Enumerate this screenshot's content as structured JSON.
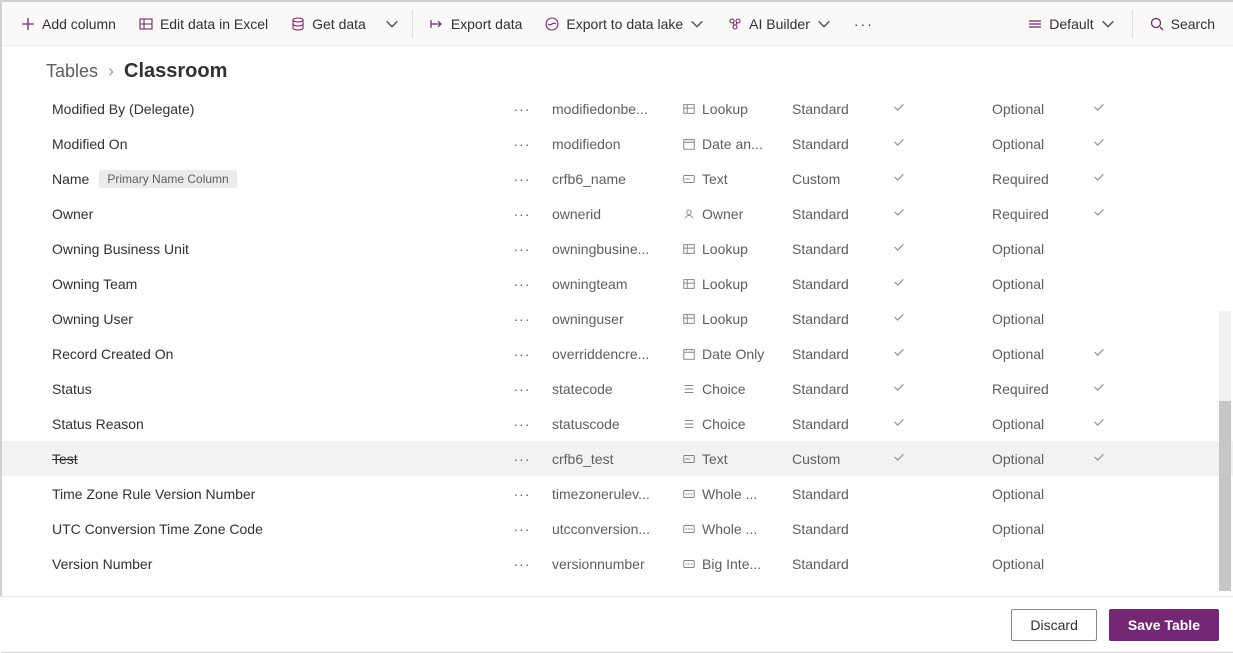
{
  "toolbar": {
    "add_column": "Add column",
    "edit_excel": "Edit data in Excel",
    "get_data": "Get data",
    "export_data": "Export data",
    "export_lake": "Export to data lake",
    "ai_builder": "AI Builder",
    "view_default": "Default",
    "search_placeholder": "Search"
  },
  "breadcrumb": {
    "parent": "Tables",
    "current": "Classroom"
  },
  "badges": {
    "primary_name": "Primary Name Column"
  },
  "rows": [
    {
      "display": "Modified By (Delegate)",
      "name": "modifiedonbe...",
      "dtype": "Lookup",
      "ctype": "Standard",
      "man1": true,
      "req": "Optional",
      "man2": true,
      "strike": false,
      "hl": false,
      "badge": false
    },
    {
      "display": "Modified On",
      "name": "modifiedon",
      "dtype": "Date an...",
      "ctype": "Standard",
      "man1": true,
      "req": "Optional",
      "man2": true,
      "strike": false,
      "hl": false,
      "badge": false
    },
    {
      "display": "Name",
      "name": "crfb6_name",
      "dtype": "Text",
      "ctype": "Custom",
      "man1": true,
      "req": "Required",
      "man2": true,
      "strike": false,
      "hl": false,
      "badge": true
    },
    {
      "display": "Owner",
      "name": "ownerid",
      "dtype": "Owner",
      "ctype": "Standard",
      "man1": true,
      "req": "Required",
      "man2": true,
      "strike": false,
      "hl": false,
      "badge": false
    },
    {
      "display": "Owning Business Unit",
      "name": "owningbusine...",
      "dtype": "Lookup",
      "ctype": "Standard",
      "man1": true,
      "req": "Optional",
      "man2": false,
      "strike": false,
      "hl": false,
      "badge": false
    },
    {
      "display": "Owning Team",
      "name": "owningteam",
      "dtype": "Lookup",
      "ctype": "Standard",
      "man1": true,
      "req": "Optional",
      "man2": false,
      "strike": false,
      "hl": false,
      "badge": false
    },
    {
      "display": "Owning User",
      "name": "owninguser",
      "dtype": "Lookup",
      "ctype": "Standard",
      "man1": true,
      "req": "Optional",
      "man2": false,
      "strike": false,
      "hl": false,
      "badge": false
    },
    {
      "display": "Record Created On",
      "name": "overriddencre...",
      "dtype": "Date Only",
      "ctype": "Standard",
      "man1": true,
      "req": "Optional",
      "man2": true,
      "strike": false,
      "hl": false,
      "badge": false
    },
    {
      "display": "Status",
      "name": "statecode",
      "dtype": "Choice",
      "ctype": "Standard",
      "man1": true,
      "req": "Required",
      "man2": true,
      "strike": false,
      "hl": false,
      "badge": false
    },
    {
      "display": "Status Reason",
      "name": "statuscode",
      "dtype": "Choice",
      "ctype": "Standard",
      "man1": true,
      "req": "Optional",
      "man2": true,
      "strike": false,
      "hl": false,
      "badge": false
    },
    {
      "display": "Test",
      "name": "crfb6_test",
      "dtype": "Text",
      "ctype": "Custom",
      "man1": true,
      "req": "Optional",
      "man2": true,
      "strike": true,
      "hl": true,
      "badge": false
    },
    {
      "display": "Time Zone Rule Version Number",
      "name": "timezonerulev...",
      "dtype": "Whole ...",
      "ctype": "Standard",
      "man1": false,
      "req": "Optional",
      "man2": false,
      "strike": false,
      "hl": false,
      "badge": false
    },
    {
      "display": "UTC Conversion Time Zone Code",
      "name": "utcconversion...",
      "dtype": "Whole ...",
      "ctype": "Standard",
      "man1": false,
      "req": "Optional",
      "man2": false,
      "strike": false,
      "hl": false,
      "badge": false
    },
    {
      "display": "Version Number",
      "name": "versionnumber",
      "dtype": "Big Inte...",
      "ctype": "Standard",
      "man1": false,
      "req": "Optional",
      "man2": false,
      "strike": false,
      "hl": false,
      "badge": false
    }
  ],
  "footer": {
    "discard": "Discard",
    "save": "Save Table"
  }
}
